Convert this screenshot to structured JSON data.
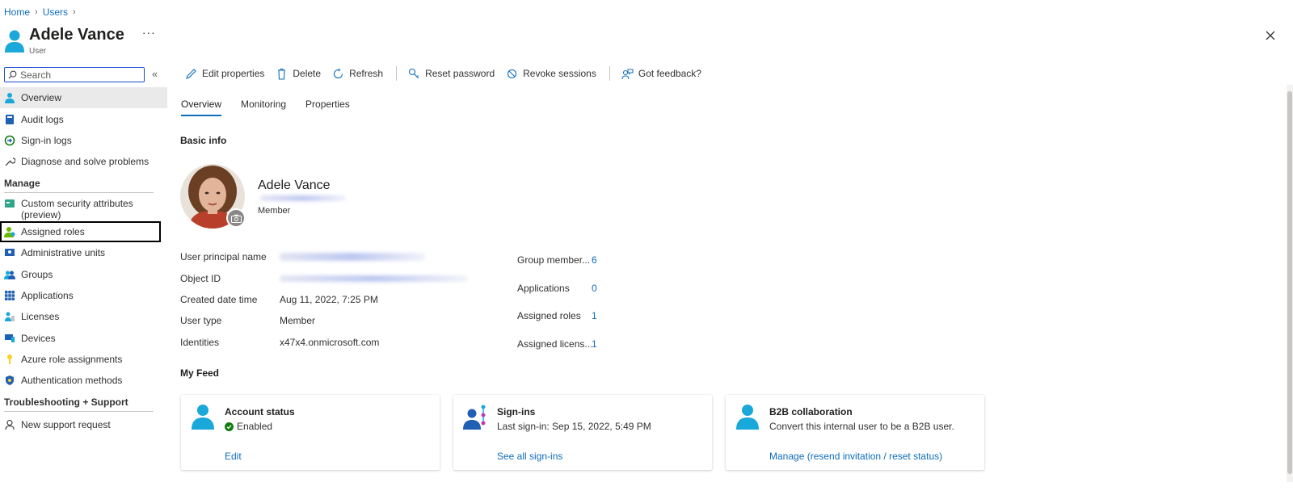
{
  "breadcrumb": [
    "Home",
    "Users"
  ],
  "header": {
    "title": "Adele Vance",
    "subtitle": "User",
    "more": "···"
  },
  "sidebar": {
    "search_placeholder": "Search",
    "items": [
      {
        "label": "Overview"
      },
      {
        "label": "Audit logs"
      },
      {
        "label": "Sign-in logs"
      },
      {
        "label": "Diagnose and solve problems"
      }
    ],
    "manage_title": "Manage",
    "manage_items": [
      {
        "label": "Custom security attributes (preview)"
      },
      {
        "label": "Assigned roles"
      },
      {
        "label": "Administrative units"
      },
      {
        "label": "Groups"
      },
      {
        "label": "Applications"
      },
      {
        "label": "Licenses"
      },
      {
        "label": "Devices"
      },
      {
        "label": "Azure role assignments"
      },
      {
        "label": "Authentication methods"
      }
    ],
    "support_title": "Troubleshooting + Support",
    "support_items": [
      {
        "label": "New support request"
      }
    ]
  },
  "toolbar": {
    "edit": "Edit properties",
    "delete": "Delete",
    "refresh": "Refresh",
    "reset_password": "Reset password",
    "revoke_sessions": "Revoke sessions",
    "feedback": "Got feedback?"
  },
  "tabs": [
    "Overview",
    "Monitoring",
    "Properties"
  ],
  "basic_info": {
    "title": "Basic info",
    "name": "Adele Vance",
    "role": "Member",
    "props": [
      {
        "key": "User principal name",
        "value": ""
      },
      {
        "key": "Object ID",
        "value": ""
      },
      {
        "key": "Created date time",
        "value": "Aug 11, 2022, 7:25 PM"
      },
      {
        "key": "User type",
        "value": "Member"
      },
      {
        "key": "Identities",
        "value": "x47x4.onmicrosoft.com"
      }
    ],
    "stats": [
      {
        "key": "Group member...",
        "value": "6"
      },
      {
        "key": "Applications",
        "value": "0"
      },
      {
        "key": "Assigned roles",
        "value": "1"
      },
      {
        "key": "Assigned licens...",
        "value": "1"
      }
    ]
  },
  "feed": {
    "title": "My Feed",
    "cards": [
      {
        "title": "Account status",
        "status": "Enabled",
        "link": "Edit"
      },
      {
        "title": "Sign-ins",
        "status": "Last sign-in: Sep 15, 2022, 5:49 PM",
        "link": "See all sign-ins"
      },
      {
        "title": "B2B collaboration",
        "status": "Convert this internal user to be a B2B user.",
        "link": "Manage (resend invitation / reset status)"
      }
    ]
  },
  "colors": {
    "accent": "#0f6cbd",
    "user_icon": "#1aa7d9",
    "enabled": "#107c10"
  }
}
